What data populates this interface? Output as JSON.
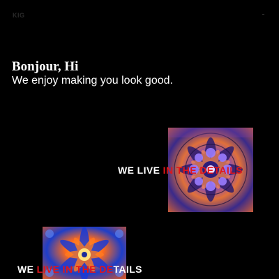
{
  "header": {
    "logo": "KIG",
    "menu_icon": "menu-icon"
  },
  "hero": {
    "greeting": "Bonjour, Hi",
    "tagline": "We enjoy making you look good."
  },
  "featured": [
    {
      "image_icon": "kaleidoscope-image",
      "slogan_white": "WE LIVE ",
      "slogan_red": "IN THE DETAILS",
      "slogan_white_end": ""
    },
    {
      "image_icon": "kaleidoscope-image",
      "slogan_white": "WE ",
      "slogan_red": "LIVE IN THE DE",
      "slogan_white_end": "TAILS"
    }
  ],
  "colors": {
    "background": "#000000",
    "text": "#ffffff",
    "accent": "#e0151b"
  }
}
